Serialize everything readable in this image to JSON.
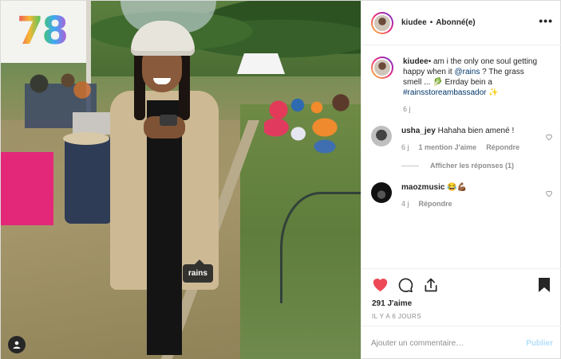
{
  "photo": {
    "sign_text": "78",
    "product_tag": "rains"
  },
  "header": {
    "username": "kiudee",
    "separator": "•",
    "follow_status": "Abonné(e)",
    "more": "•••"
  },
  "caption": {
    "username": "kiudee",
    "text_1": "• am i the only one soul getting happy when it ",
    "mention": "@rains",
    "text_2": " ? The grass smell ... 🥬 Errday bein a ",
    "hashtag": "#rainsstoreambassador",
    "text_3": " ✨",
    "age": "6 j"
  },
  "comments": [
    {
      "username": "usha_jey",
      "text": "Hahaha bien amené !",
      "age": "6 j",
      "likes": "1 mention J'aime",
      "reply": "Répondre",
      "view_replies": "Afficher les réponses (1)"
    },
    {
      "username": "maozmusic",
      "text": "😂💪🏾",
      "age": "4 j",
      "reply": "Répondre"
    }
  ],
  "actions": {
    "likes": "291 J'aime",
    "date": "IL Y A 6 JOURS"
  },
  "add_comment": {
    "placeholder": "Ajouter un commentaire…",
    "publish": "Publier"
  },
  "colors": {
    "liked_heart": "#ed4956",
    "link": "#00376b",
    "publish_disabled": "#b2dffc"
  },
  "icons": [
    "heart-icon",
    "comment-icon",
    "share-icon",
    "bookmark-icon",
    "more-icon",
    "user-tag-icon"
  ]
}
